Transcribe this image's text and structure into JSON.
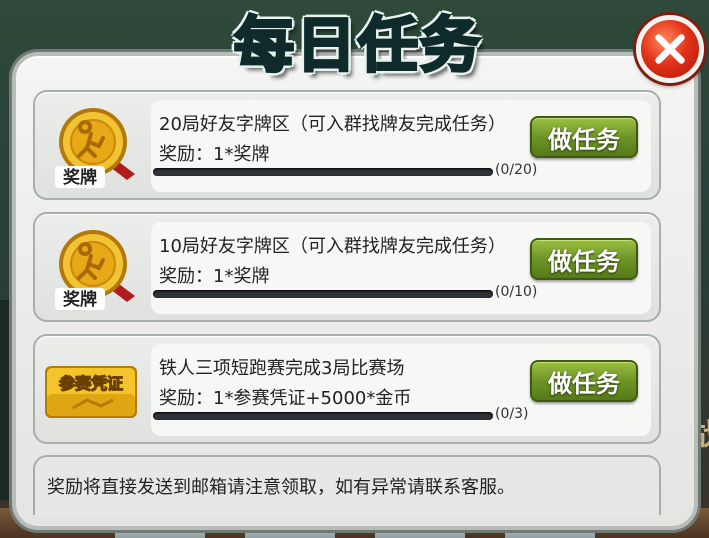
{
  "dialog": {
    "title": "每日任务",
    "close_icon": "close-x-icon"
  },
  "tasks": [
    {
      "icon": "gold-medal-icon",
      "badge_text": "奖牌",
      "title": "20局好友字牌区（可入群找牌友完成任务）",
      "reward": "奖励：1*奖牌",
      "progress_text": "(0/20)",
      "progress": 0,
      "button_label": "做任务"
    },
    {
      "icon": "gold-medal-icon",
      "badge_text": "奖牌",
      "title": "10局好友字牌区（可入群找牌友完成任务）",
      "reward": "奖励：1*奖牌",
      "progress_text": "(0/10)",
      "progress": 0,
      "button_label": "做任务"
    },
    {
      "icon": "entry-ticket-icon",
      "badge_text": "参赛凭证",
      "title": "铁人三项短跑赛完成3局比赛场",
      "reward": "奖励：1*参赛凭证+5000*金币",
      "progress_text": "(0/3)",
      "progress": 0,
      "button_label": "做任务"
    }
  ],
  "footer": {
    "note": "奖励将直接发送到邮箱请注意领取，如有异常请联系客服。"
  },
  "background": {
    "side_glyph": "战"
  },
  "colors": {
    "accent_green": "#6e9428",
    "close_red": "#e2321a",
    "title_teal": "#2f6b63",
    "medal_gold": "#e8a818"
  }
}
